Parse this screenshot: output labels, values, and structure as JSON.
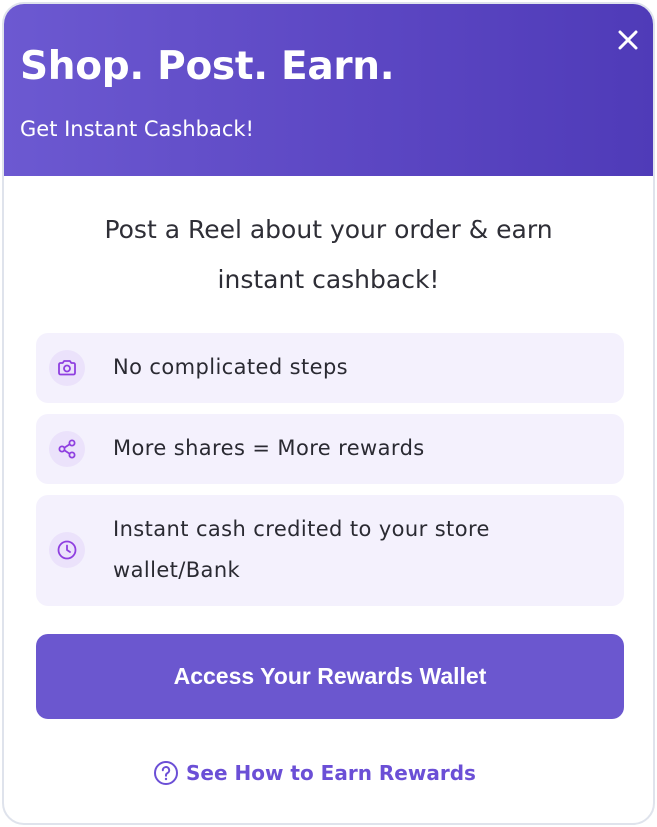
{
  "header": {
    "title": "Shop. Post. Earn.",
    "subtitle": "Get Instant Cashback!",
    "close_icon": "close-icon"
  },
  "intro": {
    "line1": "Post a Reel about your order & earn",
    "line2": "instant cashback!"
  },
  "features": [
    {
      "icon": "camera-icon",
      "text": "No complicated steps"
    },
    {
      "icon": "share-icon",
      "text": "More shares = More rewards"
    },
    {
      "icon": "clock-icon",
      "line1": "Instant cash credited to your store",
      "line2": "wallet/Bank"
    }
  ],
  "wallet_button": {
    "label": "Access Your Rewards Wallet"
  },
  "help_link": {
    "icon": "question-circle-icon",
    "label": "See How to Earn Rewards"
  },
  "colors": {
    "header_gradient_start": "#6c59d1",
    "header_gradient_end": "#4f3bb8",
    "accent": "#6b57cf",
    "link": "#6b4fd6",
    "feature_bg": "#f4f1fd",
    "icon_purple": "#8f3fe0"
  }
}
